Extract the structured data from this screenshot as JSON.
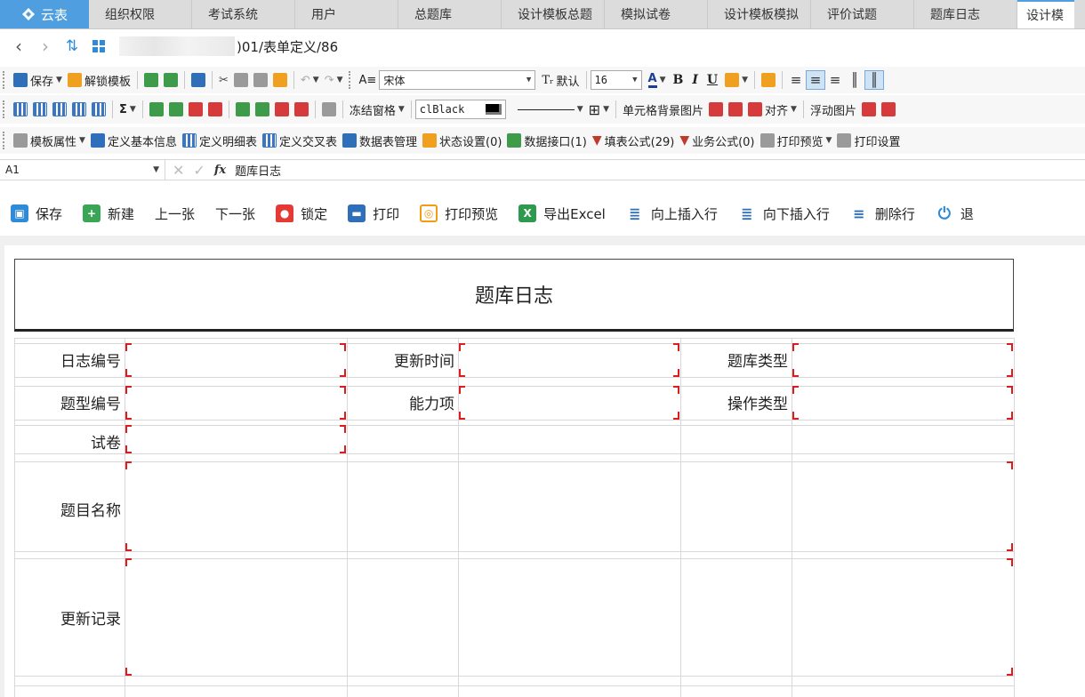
{
  "tabs": {
    "home": "云表",
    "items": [
      "组织权限",
      "考试系统",
      "用户",
      "总题库",
      "设计模板总题",
      "模拟试卷",
      "设计模板模拟",
      "评价试题",
      "题库日志",
      "设计模"
    ]
  },
  "nav": {
    "path": ")01/表单定义/86"
  },
  "toolbar1": {
    "save": "保存",
    "unlock_template": "解锁模板",
    "font_name": "宋体",
    "font_default": "默认",
    "font_size": "16"
  },
  "toolbar2": {
    "sum": "Σ",
    "freeze_panes": "冻结窗格",
    "color_value": "clBlack",
    "cell_bg_image": "单元格背景图片",
    "align": "对齐",
    "float_image": "浮动图片"
  },
  "toolbar3": {
    "template_props": "模板属性",
    "define_basic": "定义基本信息",
    "define_detail": "定义明细表",
    "define_cross": "定义交叉表",
    "table_mgmt": "数据表管理",
    "status_settings": "状态设置(0)",
    "data_interface": "数据接口(1)",
    "fill_formula": "填表公式(29)",
    "biz_formula": "业务公式(0)",
    "print_preview": "打印预览",
    "print_settings": "打印设置"
  },
  "formula_bar": {
    "cell_ref": "A1",
    "fx": "fx",
    "value": "题库日志"
  },
  "actions": {
    "save": "保存",
    "new": "新建",
    "prev": "上一张",
    "next": "下一张",
    "lock": "锁定",
    "print": "打印",
    "print_preview": "打印预览",
    "export_excel": "导出Excel",
    "insert_above": "向上插入行",
    "insert_below": "向下插入行",
    "delete_row": "删除行",
    "exit": "退"
  },
  "form": {
    "title": "题库日志",
    "labels": {
      "log_no": "日志编号",
      "update_time": "更新时间",
      "bank_type": "题库类型",
      "qtype_no": "题型编号",
      "ability": "能力项",
      "op_type": "操作类型",
      "paper": "试卷",
      "question_name": "题目名称",
      "update_record": "更新记录"
    }
  }
}
